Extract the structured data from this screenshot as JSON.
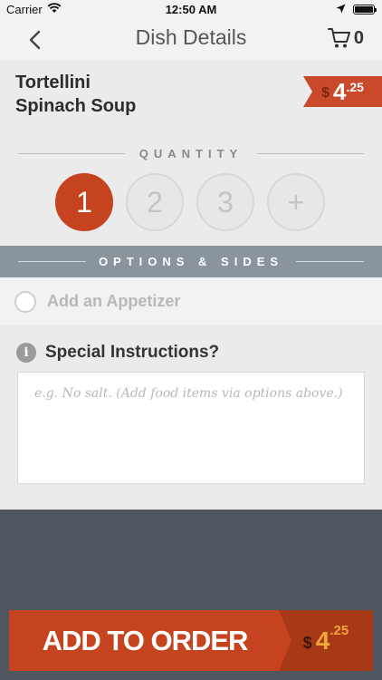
{
  "status_bar": {
    "carrier": "Carrier",
    "time": "12:50 AM"
  },
  "nav": {
    "title": "Dish Details",
    "cart_count": "0"
  },
  "dish": {
    "name_line1": "Tortellini",
    "name_line2": "Spinach Soup",
    "price_currency": "$",
    "price_dollars": "4",
    "price_cents": ".25"
  },
  "quantity": {
    "header": "QUANTITY",
    "options": [
      "1",
      "2",
      "3",
      "+"
    ],
    "selected": "1"
  },
  "options_sides": {
    "header": "OPTIONS & SIDES",
    "items": [
      {
        "label": "Add an Appetizer",
        "checked": false
      }
    ]
  },
  "instructions": {
    "title": "Special Instructions?",
    "placeholder": "e.g. No salt. (Add food items via options above.)",
    "value": ""
  },
  "add_to_order": {
    "label": "ADD TO ORDER",
    "price_currency": "$",
    "price_dollars": "4",
    "price_cents": ".25"
  },
  "colors": {
    "accent": "#c5441f",
    "accent_dark": "#a83916",
    "options_bar": "#89949c",
    "dark_bg": "#4f5660",
    "panel_bg": "#ebebeb"
  },
  "icons": [
    "wifi-icon",
    "location-arrow-icon",
    "battery-icon",
    "back-chevron-icon",
    "cart-icon",
    "info-icon"
  ]
}
